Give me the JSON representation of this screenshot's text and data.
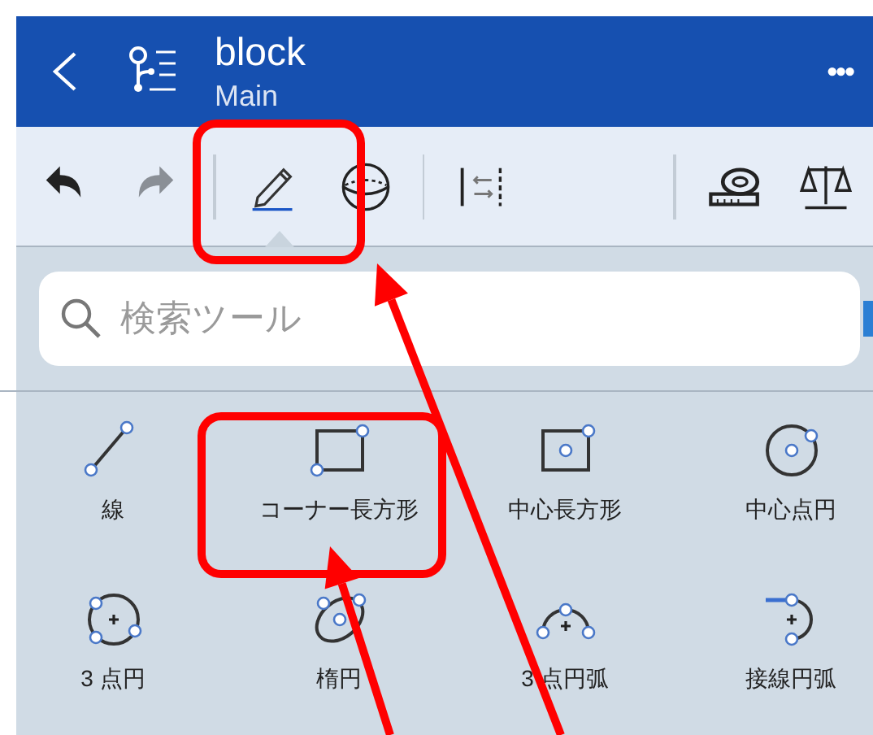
{
  "header": {
    "title": "block",
    "subtitle": "Main",
    "more": "•••"
  },
  "toolbar": [
    {
      "kind": "undo",
      "disabled": false,
      "selected": false
    },
    {
      "kind": "redo",
      "disabled": true,
      "selected": false
    },
    {
      "kind": "divider"
    },
    {
      "kind": "sketch",
      "disabled": false,
      "selected": true,
      "highlighted": true
    },
    {
      "kind": "sphere",
      "disabled": false,
      "selected": false
    },
    {
      "kind": "divider"
    },
    {
      "kind": "align",
      "disabled": false,
      "selected": false
    },
    {
      "kind": "spacer"
    },
    {
      "kind": "divider"
    },
    {
      "kind": "measure",
      "disabled": false,
      "selected": false
    },
    {
      "kind": "balance",
      "disabled": false,
      "selected": false
    }
  ],
  "search": {
    "placeholder": "検索ツール"
  },
  "tools": [
    {
      "kind": "line",
      "label": "線"
    },
    {
      "kind": "corner-rect",
      "label": "コーナー長方形",
      "highlighted": true
    },
    {
      "kind": "center-rect",
      "label": "中心長方形"
    },
    {
      "kind": "center-circle",
      "label": "中心点円"
    },
    {
      "kind": "three-point-circle",
      "label": "3 点円"
    },
    {
      "kind": "ellipse",
      "label": "楕円"
    },
    {
      "kind": "three-point-arc",
      "label": "3 点円弧"
    },
    {
      "kind": "tangent-arc",
      "label": "接線円弧"
    }
  ]
}
